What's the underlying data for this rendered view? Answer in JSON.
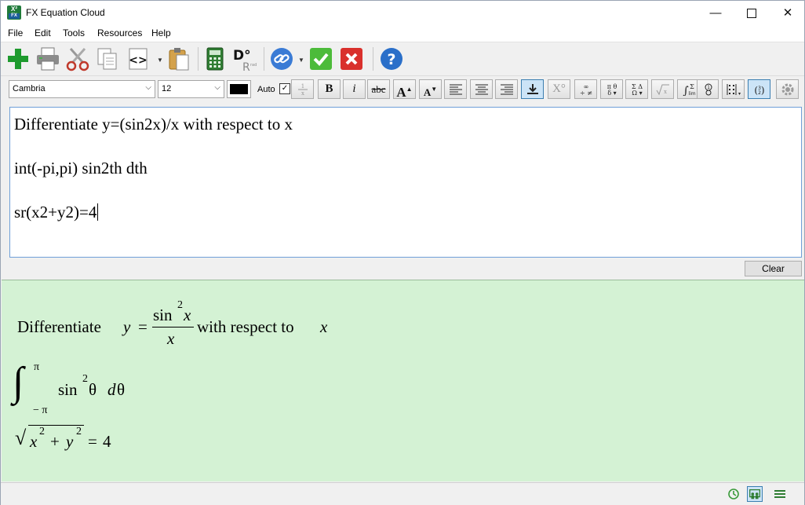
{
  "window": {
    "title": "FX Equation Cloud",
    "app_icon_text": "X²",
    "app_icon_sub": "FX",
    "minimize": "—",
    "close": "✕"
  },
  "menu": [
    "File",
    "Edit",
    "Tools",
    "Resources",
    "Help"
  ],
  "toolbar": {
    "icons": [
      "add-icon",
      "print-icon",
      "cut-icon",
      "copy-icon",
      "code-icon",
      "paste-icon",
      "calculator-icon",
      "degrees-radians-icon",
      "link-icon",
      "accept-icon",
      "cancel-icon",
      "help-icon"
    ],
    "degrees_label": "D°",
    "radians_label": "R",
    "rad_small": "rad",
    "help_label": "?"
  },
  "format_bar": {
    "font": "Cambria",
    "size": "12",
    "color": "#000000",
    "auto_label": "Auto",
    "auto_checked": "✓",
    "bold": "B",
    "italic": "i",
    "strike": "abc",
    "grow": "A",
    "shrink": "A",
    "superscript": "X°"
  },
  "editor": {
    "lines": [
      "Differentiate y=(sin2x)/x with respect to x",
      "int(-pi,pi) sin2th dth",
      "sr(x2+y2)=4"
    ]
  },
  "clear_button": "Clear",
  "output": {
    "eq1": {
      "prefix": "Differentiate",
      "y": "y",
      "equals": "=",
      "numerator": "sin",
      "num_var": "x",
      "power": "2",
      "denominator": "x",
      "suffix": "with respect to",
      "suffix_var": "x"
    },
    "eq2": {
      "integral": "∫",
      "upper": "π",
      "lower": "− π",
      "func": "sin",
      "power": "2",
      "var": "θ",
      "d": "d",
      "dvar": "θ"
    },
    "eq3": {
      "radical": "√",
      "x": "x",
      "xpow": "2",
      "plus": "+",
      "y": "y",
      "ypow": "2",
      "equals": "=",
      "value": "4"
    }
  },
  "colors": {
    "output_bg": "#d4f2d4",
    "accent": "#3c7fb1",
    "add_green": "#1e9a2e",
    "cancel_red": "#d9302c",
    "help_blue": "#2a6fc9"
  }
}
